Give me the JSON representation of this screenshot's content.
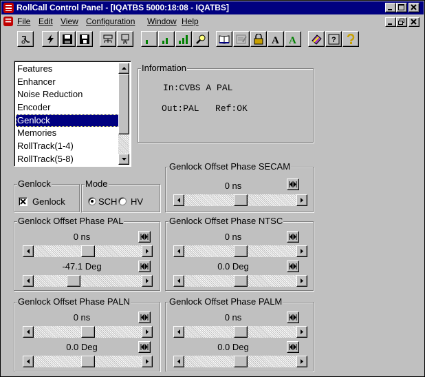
{
  "window": {
    "title": "RollCall Control Panel - [IQATBS 5000:18:08 - IQATBS]"
  },
  "menu": {
    "items": [
      {
        "label": "File"
      },
      {
        "label": "Edit"
      },
      {
        "label": "View"
      },
      {
        "label": "Configuration"
      },
      {
        "label": "Window"
      },
      {
        "label": "Help"
      }
    ]
  },
  "toolbar": {
    "text_a1": "A",
    "text_a2": "A",
    "help_label": "?"
  },
  "list": {
    "items": [
      {
        "label": "Features"
      },
      {
        "label": "Enhancer"
      },
      {
        "label": "Noise Reduction"
      },
      {
        "label": "Encoder"
      },
      {
        "label": "Genlock",
        "selected": true
      },
      {
        "label": "Memories"
      },
      {
        "label": "RollTrack(1-4)"
      },
      {
        "label": "RollTrack(5-8)"
      }
    ]
  },
  "information": {
    "title": "Information",
    "line1": "In:CVBS A PAL",
    "line2": "Out:PAL   Ref:OK"
  },
  "genlock": {
    "title": "Genlock",
    "checkbox_label": "Genlock",
    "checked": true
  },
  "mode": {
    "title": "Mode",
    "option1": "SCH",
    "option2": "HV",
    "selected": "SCH"
  },
  "groups": {
    "secam": {
      "title": "Genlock Offset Phase SECAM",
      "value1": "0 ns",
      "level1": 0.5
    },
    "pal": {
      "title": "Genlock Offset Phase PAL",
      "value1": "0 ns",
      "level1": 0.5,
      "value2": "-47.1 Deg",
      "level2": 0.35
    },
    "ntsc": {
      "title": "Genlock Offset Phase NTSC",
      "value1": "0 ns",
      "level1": 0.5,
      "value2": "0.0 Deg",
      "level2": 0.5
    },
    "paln": {
      "title": "Genlock Offset Phase PALN",
      "value1": "0 ns",
      "level1": 0.5,
      "value2": "0.0 Deg",
      "level2": 0.5
    },
    "palm": {
      "title": "Genlock Offset Phase PALM",
      "value1": "0 ns",
      "level1": 0.5,
      "value2": "0.0 Deg",
      "level2": 0.5
    }
  }
}
